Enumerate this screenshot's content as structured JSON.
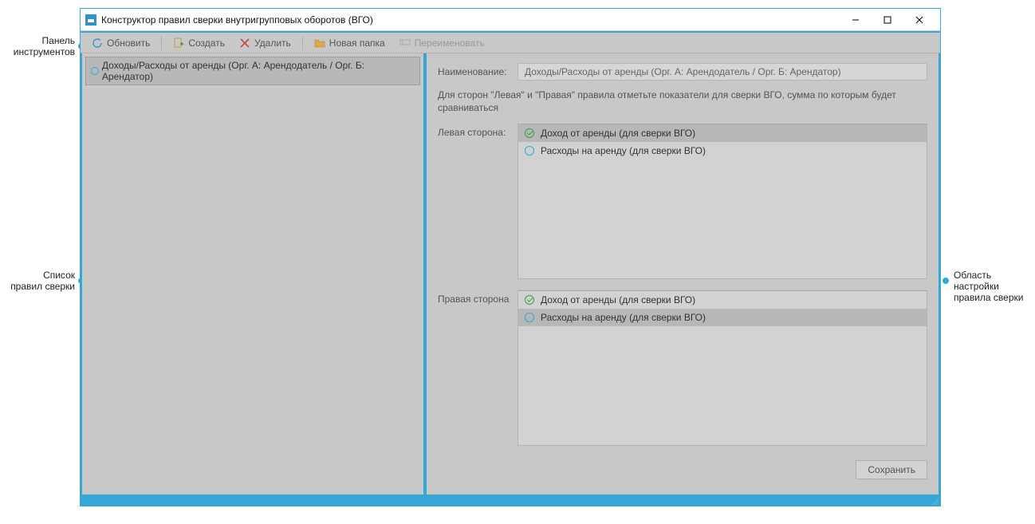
{
  "callouts": {
    "toolbar_l1": "Панель",
    "toolbar_l2": "инструментов",
    "list_l1": "Список",
    "list_l2": "правил сверки",
    "settings_l1": "Область настройки",
    "settings_l2": "правила сверки"
  },
  "window": {
    "title": "Конструктор правил сверки внутригрупповых оборотов (ВГО)"
  },
  "toolbar": {
    "refresh": "Обновить",
    "create": "Создать",
    "delete": "Удалить",
    "new_folder": "Новая папка",
    "rename": "Переименовать"
  },
  "tree": {
    "item0": "Доходы/Расходы от аренды (Орг. А: Арендодатель / Орг. Б: Арендатор)"
  },
  "form": {
    "name_label": "Наименование:",
    "name_value": "Доходы/Расходы от аренды (Орг. А: Арендодатель / Орг. Б: Арендатор)",
    "hint": "Для сторон \"Левая\" и \"Правая\" правила отметьте показатели для сверки ВГО, сумма по которым будет сравниваться",
    "left_label": "Левая сторона:",
    "right_label": "Правая сторона",
    "left": {
      "opt0": "Доход от аренды (для сверки ВГО)",
      "opt1": "Расходы на аренду (для сверки ВГО)"
    },
    "right": {
      "opt0": "Доход от аренды (для сверки ВГО)",
      "opt1": "Расходы на аренду (для сверки ВГО)"
    },
    "save": "Сохранить"
  }
}
